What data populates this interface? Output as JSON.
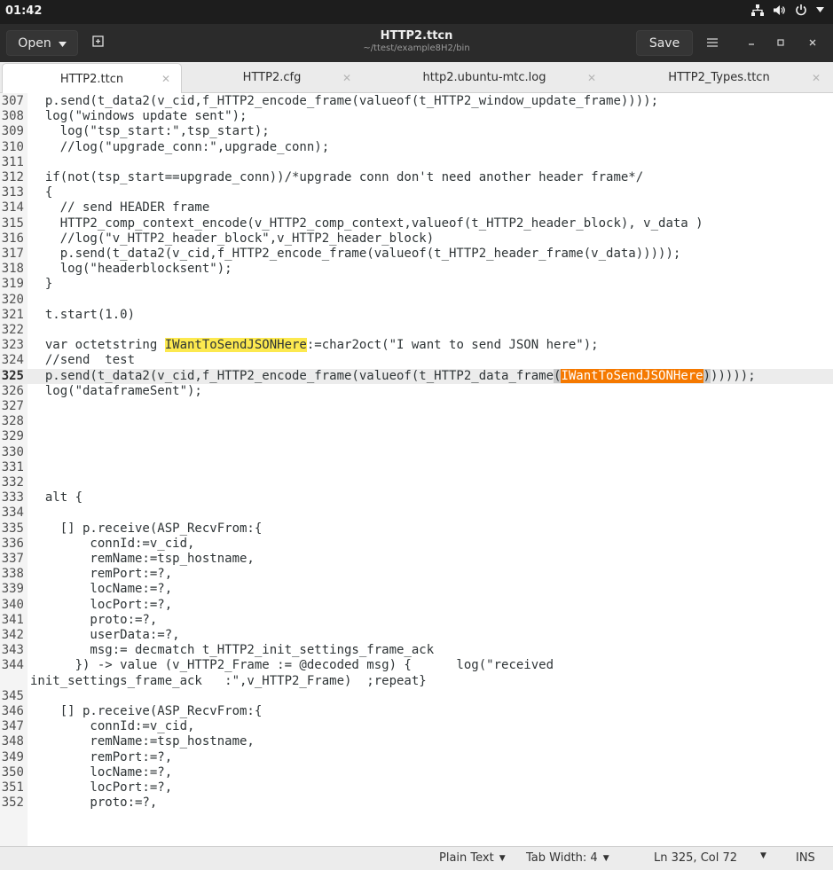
{
  "system": {
    "clock": "01:42"
  },
  "header": {
    "open_label": "Open",
    "title": "HTTP2.ttcn",
    "subtitle": "~/ttest/example8H2/bin",
    "save_label": "Save"
  },
  "tabs": [
    {
      "label": "HTTP2.ttcn",
      "active": true
    },
    {
      "label": "HTTP2.cfg",
      "active": false
    },
    {
      "label": "http2.ubuntu-mtc.log",
      "active": false
    },
    {
      "label": "HTTP2_Types.ttcn",
      "active": false
    }
  ],
  "editor": {
    "current_line": 325,
    "lines": [
      {
        "n": "307",
        "t": "  p.send(t_data2(v_cid,f_HTTP2_encode_frame(valueof(t_HTTP2_window_update_frame))));"
      },
      {
        "n": "308",
        "t": "  log(\"windows update sent\");"
      },
      {
        "n": "309",
        "t": "    log(\"tsp_start:\",tsp_start);"
      },
      {
        "n": "310",
        "t": "    //log(\"upgrade_conn:\",upgrade_conn);"
      },
      {
        "n": "311",
        "t": ""
      },
      {
        "n": "312",
        "t": "  if(not(tsp_start==upgrade_conn))/*upgrade conn don't need another header frame*/"
      },
      {
        "n": "313",
        "t": "  {"
      },
      {
        "n": "314",
        "t": "    // send HEADER frame"
      },
      {
        "n": "315",
        "t": "    HTTP2_comp_context_encode(v_HTTP2_comp_context,valueof(t_HTTP2_header_block), v_data )"
      },
      {
        "n": "316",
        "t": "    //log(\"v_HTTP2_header_block\",v_HTTP2_header_block)"
      },
      {
        "n": "317",
        "t": "    p.send(t_data2(v_cid,f_HTTP2_encode_frame(valueof(t_HTTP2_header_frame(v_data)))));"
      },
      {
        "n": "318",
        "t": "    log(\"headerblocksent\");"
      },
      {
        "n": "319",
        "t": "  }"
      },
      {
        "n": "320",
        "t": ""
      },
      {
        "n": "321",
        "t": "  t.start(1.0)"
      },
      {
        "n": "322",
        "t": ""
      },
      {
        "n": "323",
        "t": "  var octetstring ",
        "hl": "IWantToSendJSONHere",
        "hl_type": "yellow",
        "post": ":=char2oct(\"I want to send JSON here\");"
      },
      {
        "n": "324",
        "t": "  //send  test"
      },
      {
        "n": "325",
        "t": "  p.send(t_data2(v_cid,f_HTTP2_encode_frame(valueof(t_HTTP2_data_frame",
        "paren1": "(",
        "hl": "IWantToSendJSONHere",
        "hl_type": "orange",
        "paren2": ")",
        "post": ")))));"
      },
      {
        "n": "326",
        "t": "  log(\"dataframeSent\");"
      },
      {
        "n": "327",
        "t": ""
      },
      {
        "n": "328",
        "t": ""
      },
      {
        "n": "329",
        "t": ""
      },
      {
        "n": "330",
        "t": ""
      },
      {
        "n": "331",
        "t": ""
      },
      {
        "n": "332",
        "t": ""
      },
      {
        "n": "333",
        "t": "  alt {"
      },
      {
        "n": "334",
        "t": ""
      },
      {
        "n": "335",
        "t": "    [] p.receive(ASP_RecvFrom:{"
      },
      {
        "n": "336",
        "t": "        connId:=v_cid,"
      },
      {
        "n": "337",
        "t": "        remName:=tsp_hostname,"
      },
      {
        "n": "338",
        "t": "        remPort:=?,"
      },
      {
        "n": "339",
        "t": "        locName:=?,"
      },
      {
        "n": "340",
        "t": "        locPort:=?,"
      },
      {
        "n": "341",
        "t": "        proto:=?,"
      },
      {
        "n": "342",
        "t": "        userData:=?,"
      },
      {
        "n": "343",
        "t": "        msg:= decmatch t_HTTP2_init_settings_frame_ack"
      },
      {
        "n": "344",
        "t": "      }) -> value (v_HTTP2_Frame := @decoded msg) {      log(\"received"
      },
      {
        "n": "",
        "t": "init_settings_frame_ack   :\",v_HTTP2_Frame)  ;repeat}",
        "wrap": true
      },
      {
        "n": "345",
        "t": ""
      },
      {
        "n": "346",
        "t": "    [] p.receive(ASP_RecvFrom:{"
      },
      {
        "n": "347",
        "t": "        connId:=v_cid,"
      },
      {
        "n": "348",
        "t": "        remName:=tsp_hostname,"
      },
      {
        "n": "349",
        "t": "        remPort:=?,"
      },
      {
        "n": "350",
        "t": "        locName:=?,"
      },
      {
        "n": "351",
        "t": "        locPort:=?,"
      },
      {
        "n": "352",
        "t": "        proto:=?,"
      }
    ]
  },
  "status": {
    "language": "Plain Text",
    "tab_width": "Tab Width: 4",
    "position": "Ln 325, Col 72",
    "mode": "INS"
  }
}
